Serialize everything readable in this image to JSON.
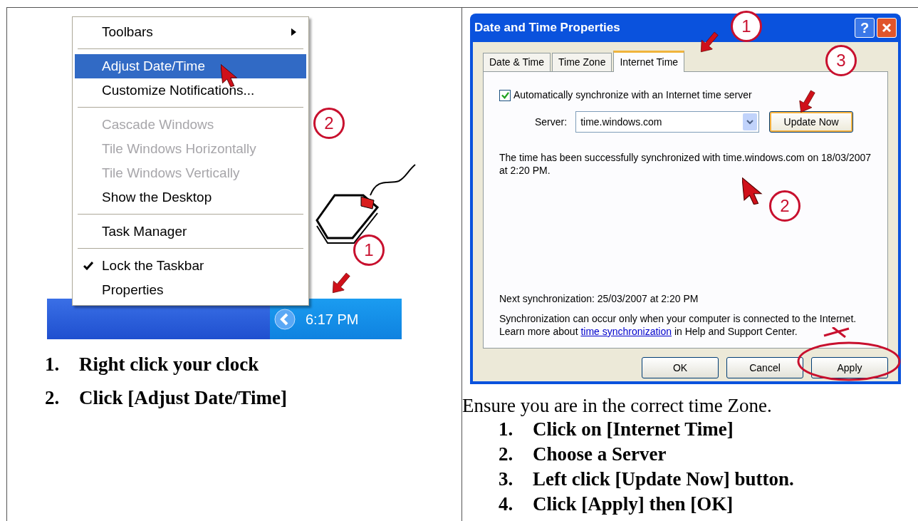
{
  "left": {
    "menu": {
      "groups": [
        [
          {
            "kind": "submenu",
            "label": "Toolbars",
            "selected": false,
            "disabled": false,
            "checked": false
          }
        ],
        [
          {
            "kind": "command",
            "label": "Adjust Date/Time",
            "selected": true,
            "disabled": false,
            "checked": false
          },
          {
            "kind": "command",
            "label": "Customize Notifications...",
            "selected": false,
            "disabled": false,
            "checked": false
          }
        ],
        [
          {
            "kind": "command",
            "label": "Cascade Windows",
            "selected": false,
            "disabled": true,
            "checked": false
          },
          {
            "kind": "command",
            "label": "Tile Windows Horizontally",
            "selected": false,
            "disabled": true,
            "checked": false
          },
          {
            "kind": "command",
            "label": "Tile Windows Vertically",
            "selected": false,
            "disabled": true,
            "checked": false
          },
          {
            "kind": "command",
            "label": "Show the Desktop",
            "selected": false,
            "disabled": false,
            "checked": false
          }
        ],
        [
          {
            "kind": "command",
            "label": "Task Manager",
            "selected": false,
            "disabled": false,
            "checked": false
          }
        ],
        [
          {
            "kind": "command",
            "label": "Lock the Taskbar",
            "selected": false,
            "disabled": false,
            "checked": true
          },
          {
            "kind": "command",
            "label": "Properties",
            "selected": false,
            "disabled": false,
            "checked": false
          }
        ]
      ]
    },
    "taskbar": {
      "clock": "6:17 PM"
    },
    "callouts": [
      "2",
      "1"
    ],
    "steps": [
      {
        "number": "1.",
        "text": "Right click your clock"
      },
      {
        "number": "2.",
        "text": "Click [Adjust Date/Time]"
      }
    ]
  },
  "right": {
    "dialog": {
      "title": "Date and Time Properties",
      "help_button": "?",
      "tabs": [
        {
          "label": "Date & Time",
          "selected": false
        },
        {
          "label": "Time Zone",
          "selected": false
        },
        {
          "label": "Internet Time",
          "selected": true
        }
      ],
      "sync_checkbox": {
        "label": "Automatically synchronize with an Internet time server",
        "checked": true
      },
      "server": {
        "label": "Server:",
        "value": "time.windows.com"
      },
      "update_button": "Update Now",
      "status": "The time has been successfully synchronized with time.windows.com on 18/03/2007 at 2:20 PM.",
      "next_sync": "Next synchronization: 25/03/2007 at 2:20 PM",
      "note_before": "Synchronization can occur only when your computer is connected to the Internet.  Learn more about ",
      "note_link": "time synchronization",
      "note_after": " in Help and Support Center.",
      "buttons": [
        "OK",
        "Cancel",
        "Apply"
      ]
    },
    "callouts": [
      "1",
      "3",
      "2"
    ],
    "intro": "Ensure you are in the correct time Zone.",
    "steps": [
      {
        "number": "1.",
        "text": "Click on [Internet Time]"
      },
      {
        "number": "2.",
        "text": "Choose a Server"
      },
      {
        "number": "3.",
        "text": "Left click [Update Now] button."
      },
      {
        "number": "4.",
        "text": "Click [Apply] then [OK]"
      }
    ]
  }
}
